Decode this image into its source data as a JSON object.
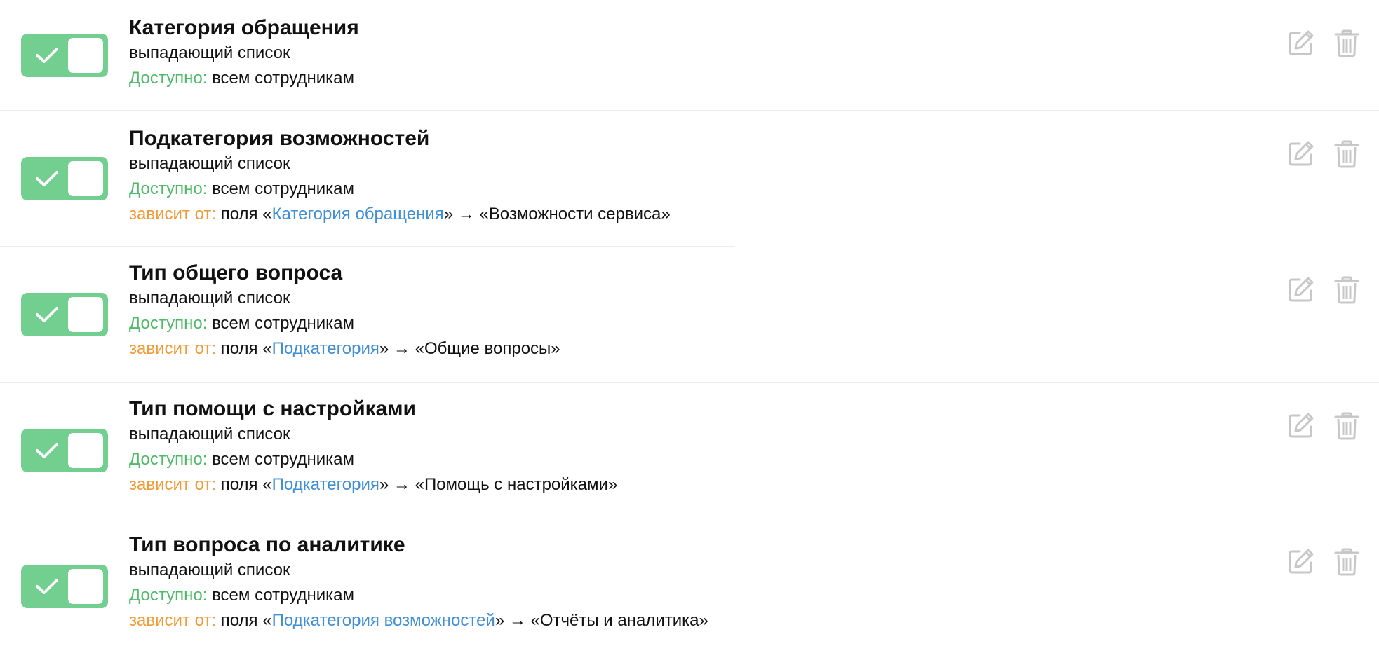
{
  "fields": [
    {
      "title": "Категория обращения",
      "type": "выпадающий список",
      "access_label": "Доступно:",
      "access_value": "всем сотрудникам",
      "enabled": true
    },
    {
      "title": "Подкатегория возможностей",
      "type": "выпадающий список",
      "access_label": "Доступно:",
      "access_value": "всем сотрудникам",
      "depends_label": "зависит от:",
      "depends_prefix": "поля «",
      "depends_field": "Категория обращения",
      "depends_suffix": "» → «Возможности сервиса»",
      "enabled": true
    },
    {
      "title": "Тип общего вопроса",
      "type": "выпадающий список",
      "access_label": "Доступно:",
      "access_value": "всем сотрудникам",
      "depends_label": "зависит от:",
      "depends_prefix": "поля «",
      "depends_field": "Подкатегория",
      "depends_suffix": "» → «Общие вопросы»",
      "enabled": true
    },
    {
      "title": "Тип помощи с настройками",
      "type": "выпадающий список",
      "access_label": "Доступно:",
      "access_value": "всем сотрудникам",
      "depends_label": "зависит от:",
      "depends_prefix": "поля «",
      "depends_field": "Подкатегория",
      "depends_suffix": "» → «Помощь с настройками»",
      "enabled": true
    },
    {
      "title": "Тип вопроса по аналитике",
      "type": "выпадающий список",
      "access_label": "Доступно:",
      "access_value": "всем сотрудникам",
      "depends_label": "зависит от:",
      "depends_prefix": "поля «",
      "depends_field": "Подкатегория возможностей",
      "depends_suffix": "» → «Отчёты и аналитика»",
      "enabled": true
    }
  ],
  "icons": {
    "toggle": "check-icon",
    "edit": "edit-icon",
    "delete": "trash-icon"
  },
  "colors": {
    "toggle_on": "#73cf8f",
    "access_label": "#4cba68",
    "depends_label": "#f29a35",
    "link": "#3f8fd6",
    "icon": "#c7c7c7"
  }
}
